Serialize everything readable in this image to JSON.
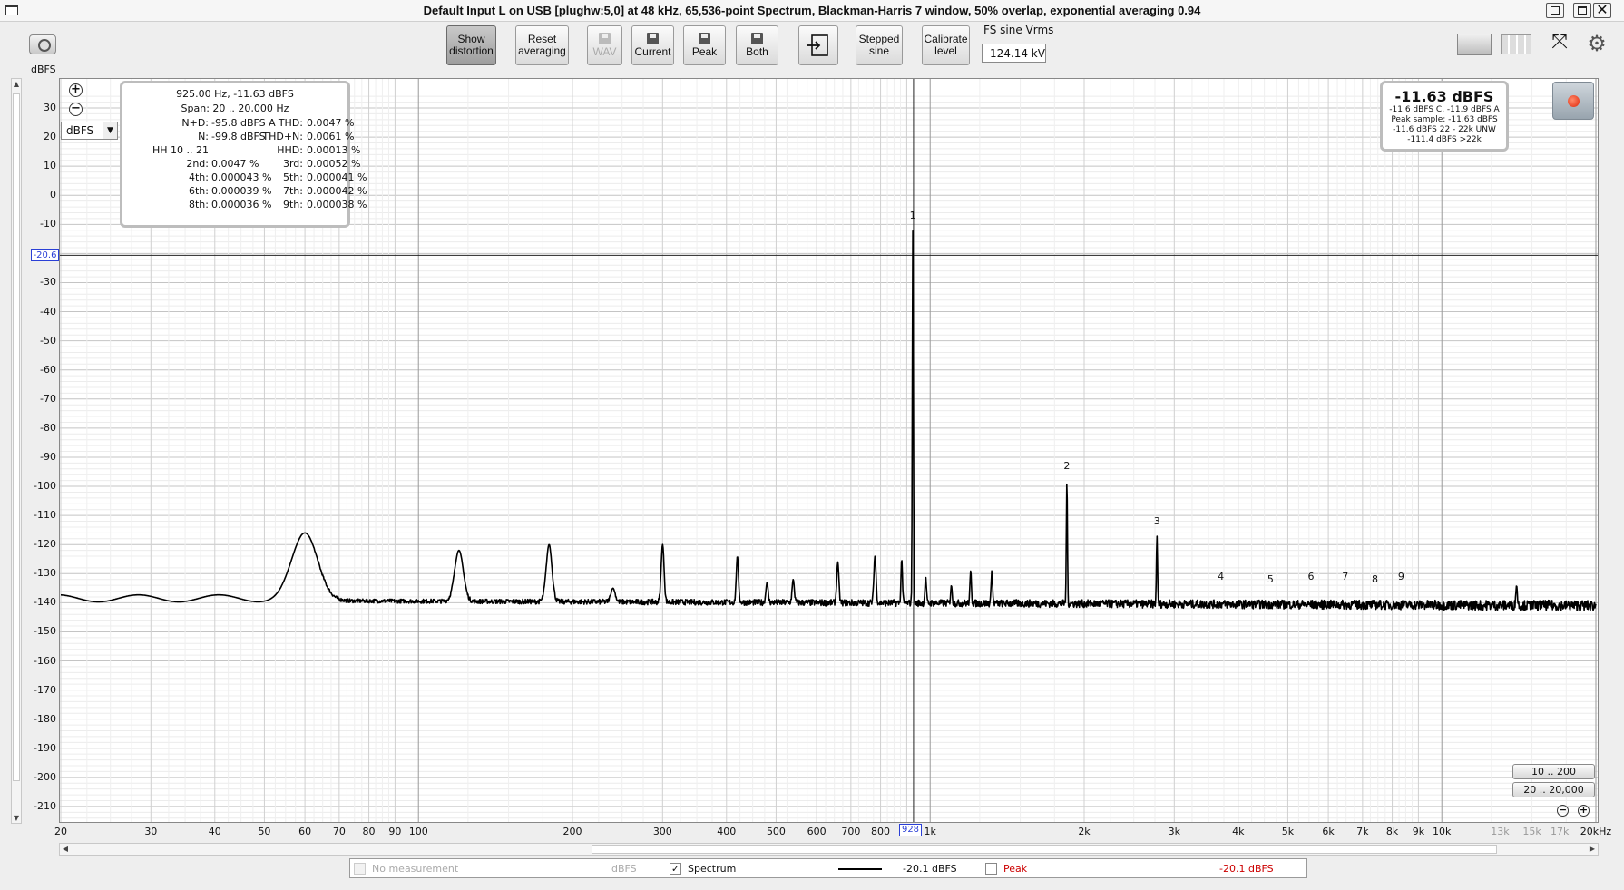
{
  "window": {
    "title": "Default Input L on USB [plughw:5,0] at 48 kHz, 65,536-point Spectrum, Blackman-Harris 7 window, 50% overlap, exponential averaging 0.94",
    "close_glyph": "✕"
  },
  "toolbar": {
    "show_distortion": [
      "Show",
      "distortion"
    ],
    "reset_averaging": [
      "Reset",
      "averaging"
    ],
    "wav": "WAV",
    "current": "Current",
    "peak": "Peak",
    "both": "Both",
    "stepped_sine": [
      "Stepped",
      "sine"
    ],
    "calibrate_level": [
      "Calibrate",
      "level"
    ],
    "fs_label": "FS sine Vrms",
    "fs_value": "124.14 kV"
  },
  "icons": {
    "camera": "camera-icon",
    "save": "save-icon",
    "export": "export-icon",
    "layout": "layout-icon",
    "columns": "columns-icon",
    "expand": "expand-arrows-icon",
    "gear": "gear-icon",
    "record": "record-icon"
  },
  "plot": {
    "unit_label": "dBFS",
    "unit_select": "dBFS",
    "cursor_y": "-20.6",
    "cursor_x": "928",
    "y_ticks": [
      "30",
      "20",
      "10",
      "0",
      "-10",
      "-20",
      "-30",
      "-40",
      "-50",
      "-60",
      "-70",
      "-80",
      "-90",
      "-100",
      "-110",
      "-120",
      "-130",
      "-140",
      "-150",
      "-160",
      "-170",
      "-180",
      "-190",
      "-200",
      "-210"
    ],
    "x_ticks": [
      {
        "label": "20",
        "f": 20
      },
      {
        "label": "30",
        "f": 30
      },
      {
        "label": "40",
        "f": 40
      },
      {
        "label": "50",
        "f": 50
      },
      {
        "label": "60",
        "f": 60
      },
      {
        "label": "70",
        "f": 70
      },
      {
        "label": "80",
        "f": 80
      },
      {
        "label": "90",
        "f": 90
      },
      {
        "label": "100",
        "f": 100
      },
      {
        "label": "200",
        "f": 200
      },
      {
        "label": "300",
        "f": 300
      },
      {
        "label": "400",
        "f": 400
      },
      {
        "label": "500",
        "f": 500
      },
      {
        "label": "600",
        "f": 600
      },
      {
        "label": "700",
        "f": 700
      },
      {
        "label": "800",
        "f": 800
      },
      {
        "label": "9",
        "f": 880
      },
      {
        "label": "1k",
        "f": 1000
      },
      {
        "label": "2k",
        "f": 2000
      },
      {
        "label": "3k",
        "f": 3000
      },
      {
        "label": "4k",
        "f": 4000
      },
      {
        "label": "5k",
        "f": 5000
      },
      {
        "label": "6k",
        "f": 6000
      },
      {
        "label": "7k",
        "f": 7000
      },
      {
        "label": "8k",
        "f": 8000
      },
      {
        "label": "9k",
        "f": 9000
      },
      {
        "label": "10k",
        "f": 10000
      },
      {
        "label": "13k",
        "f": 13000,
        "grey": true
      },
      {
        "label": "15k",
        "f": 15000,
        "grey": true
      },
      {
        "label": "17k",
        "f": 17000,
        "grey": true
      },
      {
        "label": "20kHz",
        "f": 20000
      }
    ],
    "harmonic_labels": [
      {
        "label": "1",
        "f": 925,
        "db": -10
      },
      {
        "label": "2",
        "f": 1850,
        "db": -96
      },
      {
        "label": "3",
        "f": 2775,
        "db": -115
      },
      {
        "label": "4",
        "f": 3700,
        "db": -134
      },
      {
        "label": "5",
        "f": 4625,
        "db": -135
      },
      {
        "label": "6",
        "f": 5550,
        "db": -134
      },
      {
        "label": "7",
        "f": 6475,
        "db": -134
      },
      {
        "label": "8",
        "f": 7400,
        "db": -135
      },
      {
        "label": "9",
        "f": 8325,
        "db": -134
      }
    ]
  },
  "distortion": {
    "header": "925.00 Hz, -11.63 dBFS",
    "span": "Span: 20 .. 20,000 Hz",
    "rows": [
      {
        "l1": "N+D:",
        "v1": "-95.8 dBFS A",
        "l2": "THD:",
        "v2": "0.0047 %"
      },
      {
        "l1": "N:",
        "v1": "-99.8 dBFS",
        "l2": "THD+N:",
        "v2": "0.0061 %"
      },
      {
        "l1": "HH 10 .. 21",
        "v1": "",
        "l2": "HHD:",
        "v2": "0.00013 %"
      },
      {
        "l1": "2nd:",
        "v1": "0.0047 %",
        "l2": "3rd:",
        "v2": "0.00052 %"
      },
      {
        "l1": "4th:",
        "v1": "0.000043 %",
        "l2": "5th:",
        "v2": "0.000041 %"
      },
      {
        "l1": "6th:",
        "v1": "0.000039 %",
        "l2": "7th:",
        "v2": "0.000042 %"
      },
      {
        "l1": "8th:",
        "v1": "0.000036 %",
        "l2": "9th:",
        "v2": "0.000038 %"
      }
    ]
  },
  "level": {
    "big": "-11.63 dBFS",
    "lines": [
      "-11.6 dBFS C, -11.9 dBFS A",
      "Peak sample: -11.63 dBFS",
      "-11.6 dBFS 22 - 22k UNW",
      "-111.4 dBFS >22k"
    ]
  },
  "ranges": {
    "r1": "10 .. 200",
    "r2": "20 .. 20,000",
    "zoom_out": "−",
    "zoom_in": "+"
  },
  "legend": {
    "no_measurement": "No measurement",
    "no_measurement_unit": "dBFS",
    "spectrum": "Spectrum",
    "spectrum_value": "-20.1 dBFS",
    "peak": "Peak",
    "peak_value": "-20.1 dBFS",
    "peak_color": "#cc0000",
    "check": "✓"
  },
  "chart_data": {
    "type": "line",
    "xscale": "log",
    "xlim": [
      20,
      20000
    ],
    "ylim": [
      -215,
      35
    ],
    "ylabel": "dBFS",
    "noise_floor": -139,
    "peaks": [
      {
        "f": 60,
        "db": -116,
        "w": 0.035
      },
      {
        "f": 120,
        "db": -122,
        "w": 0.012
      },
      {
        "f": 180,
        "db": -120,
        "w": 0.008
      },
      {
        "f": 240,
        "db": -135,
        "w": 0.006
      },
      {
        "f": 300,
        "db": -120,
        "w": 0.004
      },
      {
        "f": 420,
        "db": -124,
        "w": 0.003
      },
      {
        "f": 480,
        "db": -133,
        "w": 0.003
      },
      {
        "f": 540,
        "db": -132,
        "w": 0.003
      },
      {
        "f": 660,
        "db": -126,
        "w": 0.003
      },
      {
        "f": 780,
        "db": -124,
        "w": 0.003
      },
      {
        "f": 880,
        "db": -125,
        "w": 0.002
      },
      {
        "f": 925,
        "db": -11.6,
        "w": 0.0015
      },
      {
        "f": 980,
        "db": -131,
        "w": 0.002
      },
      {
        "f": 1100,
        "db": -134,
        "w": 0.002
      },
      {
        "f": 1200,
        "db": -129,
        "w": 0.002
      },
      {
        "f": 1320,
        "db": -129,
        "w": 0.002
      },
      {
        "f": 1850,
        "db": -98,
        "w": 0.0015
      },
      {
        "f": 2775,
        "db": -117,
        "w": 0.0015
      },
      {
        "f": 14000,
        "db": -134,
        "w": 0.002
      }
    ]
  }
}
